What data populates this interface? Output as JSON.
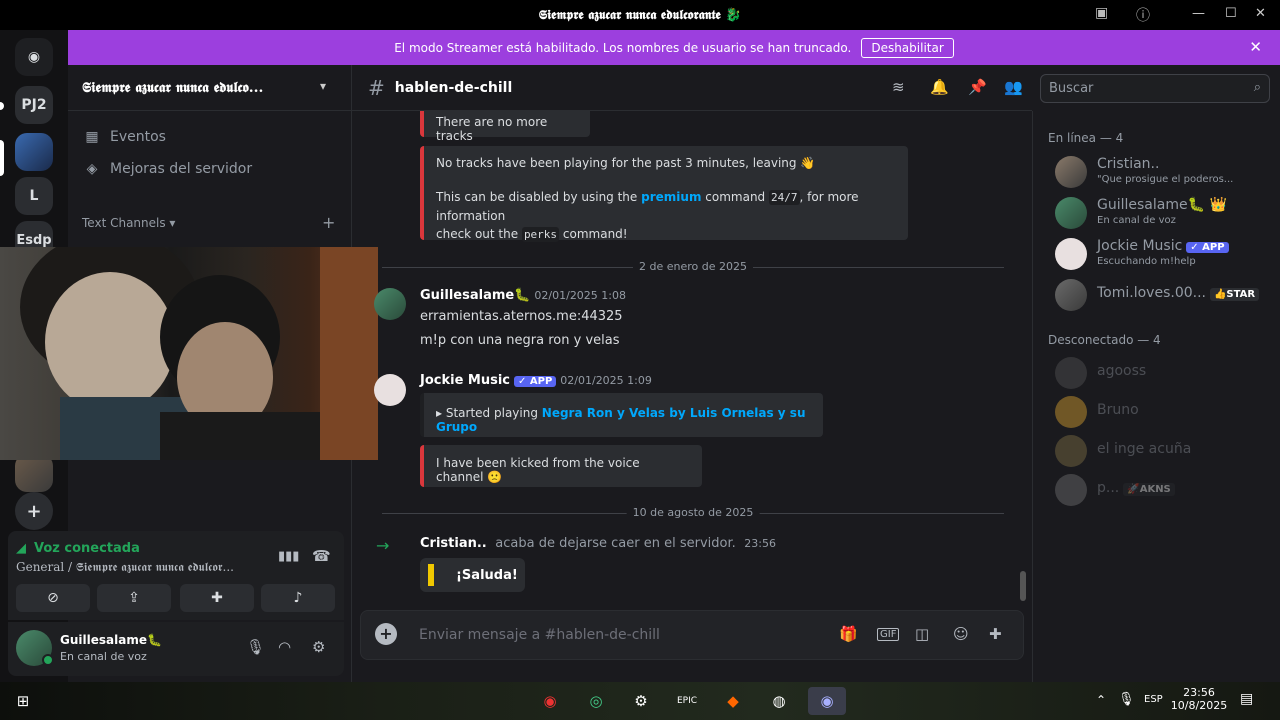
{
  "window": {
    "title": "𝕾𝖎𝖊𝖒𝖕𝖗𝖊 𝖆𝖟𝖚𝖈𝖆𝖗 𝖓𝖚𝖓𝖈𝖆 𝖊𝖉𝖚𝖑𝖈𝖔𝖗𝖆𝖓𝖙𝖊 🐉"
  },
  "rail": {
    "servers": [
      "PJ2",
      "L",
      "Esdp"
    ]
  },
  "banner": {
    "text": "El modo Streamer está habilitado. Los nombres de usuario se han truncado.",
    "button": "Deshabilitar"
  },
  "server": {
    "name": "𝕾𝖎𝖊𝖒𝖕𝖗𝖊 𝖆𝖟𝖚𝖈𝖆𝖗 𝖓𝖚𝖓𝖈𝖆 𝖊𝖉𝖚𝖑𝖈𝖔...",
    "events": "Eventos",
    "boosts": "Mejoras del servidor",
    "text_channels": "Text Channels"
  },
  "voice": {
    "status": "Voz conectada",
    "location": "General / 𝕾𝖎𝖊𝖒𝖕𝖗𝖊 𝖆𝖟𝖚𝖈𝖆𝖗 𝖓𝖚𝖓𝖈𝖆 𝖊𝖉𝖚𝖑𝖈𝖔𝖗..."
  },
  "user": {
    "name": "Guillesalame🐛",
    "status": "En canal de voz"
  },
  "channel": {
    "name": "hablen-de-chill"
  },
  "search": {
    "placeholder": "Buscar"
  },
  "messages": {
    "embed1": "There are no more tracks",
    "embed2_line1": "No tracks have been playing for the past 3 minutes, leaving 👋",
    "embed2_pre": "This can be disabled by using the",
    "embed2_premium": "premium",
    "embed2_mid": "command",
    "embed2_code": "24/7",
    "embed2_post": ", for more information",
    "embed2_line3a": "check out the",
    "embed2_code2": "perks",
    "embed2_line3b": "command!",
    "date1": "2 de enero de 2025",
    "m1_author": "Guillesalame🐛",
    "m1_time": "02/01/2025 1:08",
    "m1_line1": "erramientas.aternos.me:44325",
    "m1_line2": "m!p con una negra ron y velas",
    "m2_author": "Jockie Music",
    "m2_app": "✓ APP",
    "m2_time": "02/01/2025 1:09",
    "m2_embed_pre": "Started playing",
    "m2_embed_link": "Negra Ron y Velas by Luis Ornelas y su Grupo",
    "m2_embed2": "I have been kicked from the voice channel 🙁",
    "date2": "10 de agosto de 2025",
    "m3_author": "Cristian..",
    "m3_text": "acaba de dejarse caer en el servidor.",
    "m3_time": "23:56",
    "m3_button": "¡Saluda!"
  },
  "composer": {
    "placeholder": "Enviar mensaje a #hablen-de-chill"
  },
  "members": {
    "online_header": "En línea — 4",
    "offline_header": "Desconectado — 4",
    "online": [
      {
        "name": "Cristian..",
        "status": "\"Que prosigue el poderos..."
      },
      {
        "name": "Guillesalame🐛 👑",
        "status": "En canal de voz"
      },
      {
        "name": "Jockie Music",
        "tag": "✓ APP",
        "status": "Escuchando m!help"
      },
      {
        "name": "Tomi.loves.00...",
        "tag": "👍STAR",
        "status": ""
      }
    ],
    "offline": [
      {
        "name": "agooss"
      },
      {
        "name": "Bruno"
      },
      {
        "name": "el inge acuña"
      },
      {
        "name": "p...",
        "tag": "🚀AKNS"
      }
    ]
  },
  "taskbar": {
    "lang": "ESP",
    "time": "23:56",
    "date": "10/8/2025"
  }
}
